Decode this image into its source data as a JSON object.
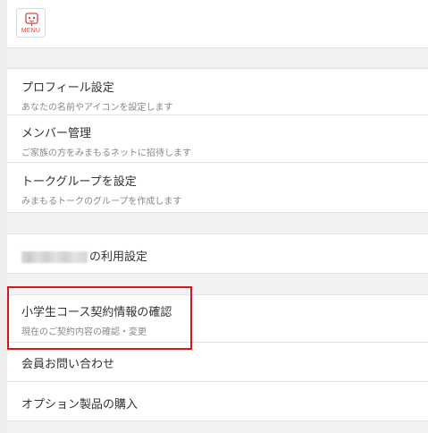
{
  "header": {
    "menu_label": "MENU",
    "menu_icon": "robot-face-icon",
    "accent_color": "#e83d3d"
  },
  "items": [
    {
      "title": "プロフィール設定",
      "subtitle": "あなたの名前やアイコンを設定します"
    },
    {
      "title": "メンバー管理",
      "subtitle": "ご家族の方をみまもるネットに招待します"
    },
    {
      "title": "トークグループを設定",
      "subtitle": "みまもるトークのグループを作成します"
    }
  ],
  "usage_settings": {
    "title_suffix": "の利用設定"
  },
  "contract": {
    "title": "小学生コース契約情報の確認",
    "subtitle": "現在のご契約内容の確認・変更"
  },
  "inquiry": {
    "title": "会員お問い合わせ"
  },
  "options": {
    "title": "オプション製品の購入"
  },
  "highlight_color": "#d6171c"
}
